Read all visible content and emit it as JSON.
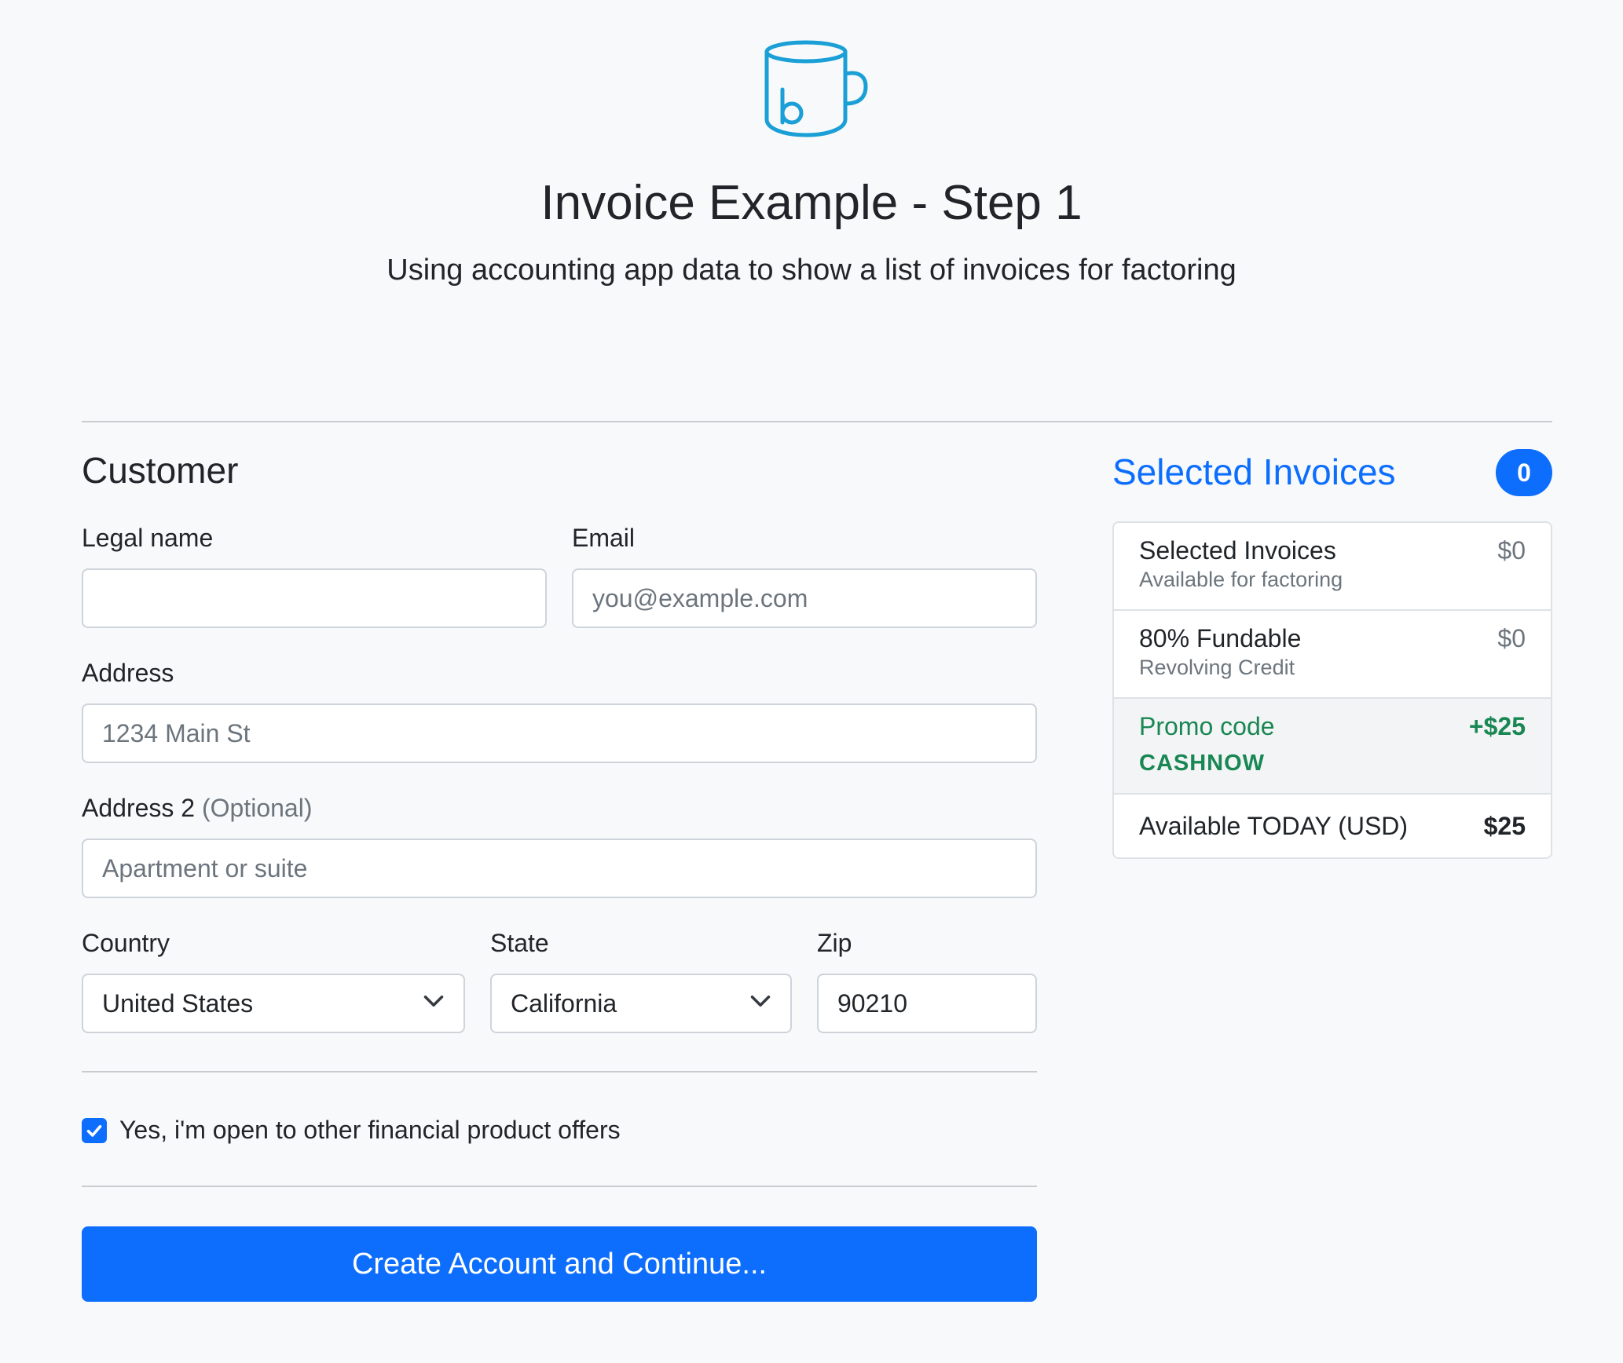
{
  "header": {
    "logo_icon": "mug-b-icon",
    "title": "Invoice Example - Step 1",
    "subtitle": "Using accounting app data to show a list of invoices for factoring"
  },
  "customer_form": {
    "section_title": "Customer",
    "legal_name": {
      "label": "Legal name",
      "value": "",
      "placeholder": ""
    },
    "email": {
      "label": "Email",
      "value": "",
      "placeholder": "you@example.com"
    },
    "address": {
      "label": "Address",
      "value": "",
      "placeholder": "1234 Main St"
    },
    "address2": {
      "label": "Address 2",
      "optional_label": "(Optional)",
      "value": "",
      "placeholder": "Apartment or suite"
    },
    "country": {
      "label": "Country",
      "selected": "United States"
    },
    "state": {
      "label": "State",
      "selected": "California"
    },
    "zip": {
      "label": "Zip",
      "value": "90210"
    },
    "offers_checkbox": {
      "label": "Yes, i'm open to other financial product offers",
      "checked": true
    },
    "submit_label": "Create Account and Continue..."
  },
  "summary": {
    "title": "Selected Invoices",
    "count": "0",
    "rows": [
      {
        "title": "Selected Invoices",
        "subtitle": "Available for factoring",
        "value": "$0"
      },
      {
        "title": "80% Fundable",
        "subtitle": "Revolving Credit",
        "value": "$0"
      }
    ],
    "promo": {
      "title": "Promo code",
      "code": "CASHNOW",
      "value": "+$25"
    },
    "total": {
      "label": "Available TODAY (USD)",
      "value": "$25"
    }
  },
  "colors": {
    "primary": "#0d6efd",
    "success": "#198754",
    "logo": "#1a9fd6",
    "background": "#f8f9fa"
  }
}
